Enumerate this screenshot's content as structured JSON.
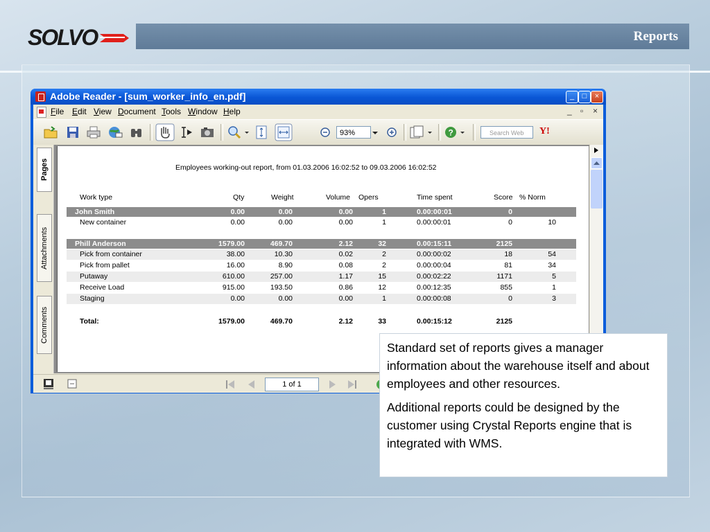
{
  "slide": {
    "title": "Reports",
    "logo_text": "SOLVO"
  },
  "window": {
    "title": "Adobe Reader - [sum_worker_info_en.pdf]",
    "controls": {
      "minimize": "_",
      "maximize": "□",
      "close": "×"
    }
  },
  "menu": {
    "items": [
      "File",
      "Edit",
      "View",
      "Document",
      "Tools",
      "Window",
      "Help"
    ],
    "mdi_min": "_",
    "mdi_restore": "▫",
    "mdi_close": "×"
  },
  "toolbar": {
    "zoom_value": "93%",
    "search_placeholder": "Search Web",
    "yahoo_label": "Y!",
    "icons": [
      "open-icon",
      "save-icon",
      "print-icon",
      "email-icon",
      "find-icon",
      "hand-tool-icon",
      "select-text-icon",
      "snapshot-icon",
      "zoom-in-tool-icon",
      "fit-page-icon",
      "fit-width-icon",
      "zoom-out-icon",
      "zoom-plus-icon",
      "pages-icon",
      "help-icon"
    ]
  },
  "nav_tabs": [
    "Pages",
    "Attachments",
    "Comments"
  ],
  "report": {
    "heading": "Employees working-out report, from 01.03.2006  16:02:52 to 09.03.2006  16:02:52",
    "columns": [
      "Work type",
      "Qty",
      "Weight",
      "Volume",
      "Opers",
      "Time spent",
      "Score",
      "% Norm"
    ],
    "groups": [
      {
        "name": "John Smith",
        "summary": [
          "0.00",
          "0.00",
          "0.00",
          "1",
          "0.00:00:01",
          "0",
          ""
        ],
        "rows": [
          [
            "New container",
            "0.00",
            "0.00",
            "0.00",
            "1",
            "0.00:00:01",
            "0",
            "10"
          ]
        ]
      },
      {
        "name": "Phill Anderson",
        "summary": [
          "1579.00",
          "469.70",
          "2.12",
          "32",
          "0.00:15:11",
          "2125",
          ""
        ],
        "rows": [
          [
            "Pick from container",
            "38.00",
            "10.30",
            "0.02",
            "2",
            "0.00:00:02",
            "18",
            "54"
          ],
          [
            "Pick from pallet",
            "16.00",
            "8.90",
            "0.08",
            "2",
            "0.00:00:04",
            "81",
            "34"
          ],
          [
            "Putaway",
            "610.00",
            "257.00",
            "1.17",
            "15",
            "0.00:02:22",
            "1171",
            "5"
          ],
          [
            "Receive Load",
            "915.00",
            "193.50",
            "0.86",
            "12",
            "0.00:12:35",
            "855",
            "1"
          ],
          [
            "Staging",
            "0.00",
            "0.00",
            "0.00",
            "1",
            "0.00:00:08",
            "0",
            "3"
          ]
        ]
      }
    ],
    "total": [
      "Total:",
      "1579.00",
      "469.70",
      "2.12",
      "33",
      "0.00:15:12",
      "2125"
    ]
  },
  "statusbar": {
    "page_indicator": "1 of 1"
  },
  "callout": {
    "p1": "Standard set of reports gives a manager information about the warehouse itself and about employees and other resources.",
    "p2": "Additional reports could be designed by the customer using Crystal Reports engine that is integrated with WMS."
  }
}
